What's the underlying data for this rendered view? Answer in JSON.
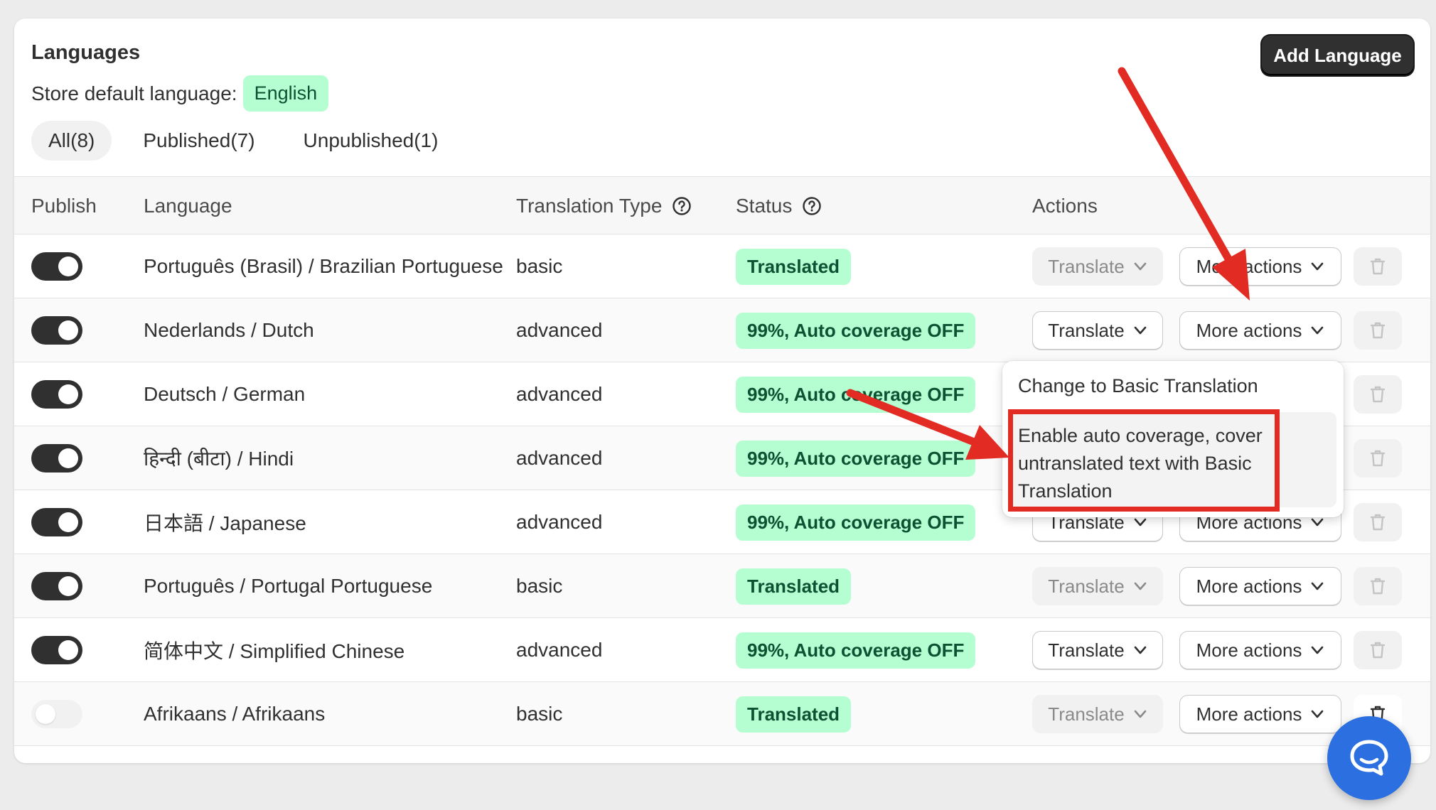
{
  "header": {
    "title": "Languages",
    "default_label": "Store default language:",
    "default_language": "English",
    "add_button": "Add Language"
  },
  "tabs": [
    {
      "label": "All(8)",
      "active": true
    },
    {
      "label": "Published(7)",
      "active": false
    },
    {
      "label": "Unpublished(1)",
      "active": false
    }
  ],
  "columns": {
    "publish": "Publish",
    "language": "Language",
    "translation_type": "Translation Type",
    "status": "Status",
    "actions": "Actions"
  },
  "rows": [
    {
      "published": true,
      "language": "Português (Brasil) / Brazilian Portuguese",
      "type": "basic",
      "status": "Translated",
      "translate_enabled": false
    },
    {
      "published": true,
      "language": "Nederlands / Dutch",
      "type": "advanced",
      "status": "99%, Auto coverage OFF",
      "translate_enabled": true
    },
    {
      "published": true,
      "language": "Deutsch / German",
      "type": "advanced",
      "status": "99%, Auto coverage OFF",
      "translate_enabled": true
    },
    {
      "published": true,
      "language": "हिन्दी (बीटा) / Hindi",
      "type": "advanced",
      "status": "99%, Auto coverage OFF",
      "translate_enabled": true
    },
    {
      "published": true,
      "language": "日本語 / Japanese",
      "type": "advanced",
      "status": "99%, Auto coverage OFF",
      "translate_enabled": true
    },
    {
      "published": true,
      "language": "Português / Portugal Portuguese",
      "type": "basic",
      "status": "Translated",
      "translate_enabled": false
    },
    {
      "published": true,
      "language": "简体中文 / Simplified Chinese",
      "type": "advanced",
      "status": "99%, Auto coverage OFF",
      "translate_enabled": true
    },
    {
      "published": false,
      "language": "Afrikaans / Afrikaans",
      "type": "basic",
      "status": "Translated",
      "translate_enabled": false
    }
  ],
  "buttons": {
    "translate": "Translate",
    "more_actions": "More actions"
  },
  "dropdown": {
    "item1": "Change to Basic Translation",
    "item2_line1": "Enable auto coverage, cover",
    "item2_line2": "untranslated text with Basic",
    "item2_line3": "Translation"
  },
  "colors": {
    "accent_dark": "#303030",
    "status_bg": "#b4fed2",
    "status_text": "#0c5132",
    "annotation_red": "#e22b22",
    "chat_blue": "#2b6fe0"
  }
}
